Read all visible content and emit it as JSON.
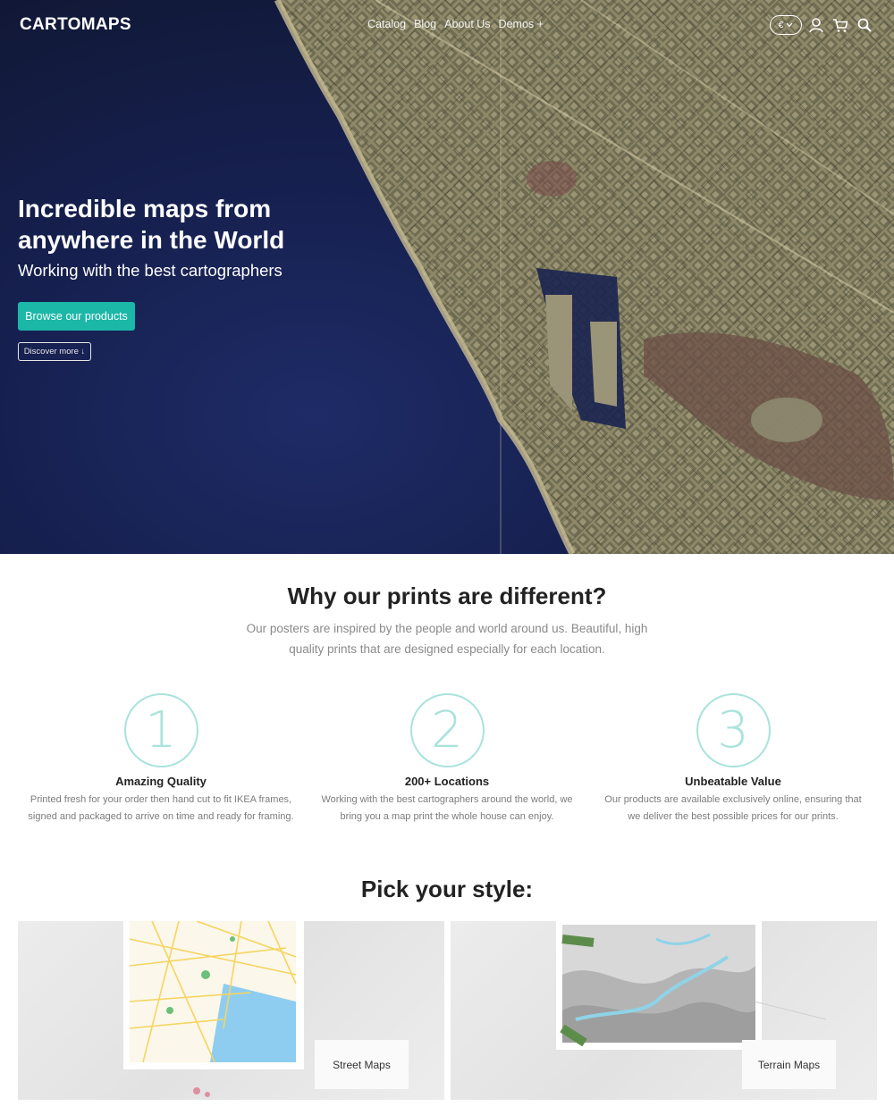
{
  "header": {
    "logo": "CARTOMAPS",
    "nav": [
      "Catalog",
      "Blog",
      "About Us",
      "Demos +"
    ],
    "currency": "€",
    "icons": [
      "account-icon",
      "cart-icon",
      "search-icon"
    ]
  },
  "hero": {
    "title": "Incredible maps from anywhere in the World",
    "subtitle": "Working with the best cartographers",
    "primary_button": "Browse our products",
    "secondary_button": "Discover more ↓"
  },
  "why": {
    "title": "Why our prints are different?",
    "description": "Our posters are inspired by the people and world around us. Beautiful, high quality prints that are designed especially for each location.",
    "features": [
      {
        "number": "1",
        "title": "Amazing Quality",
        "description": "Printed fresh for your order then hand cut to fit IKEA frames, signed and packaged to arrive on time and ready for framing."
      },
      {
        "number": "2",
        "title": "200+ Locations",
        "description": "Working with the best cartographers around the world, we bring you a map print the whole house can enjoy."
      },
      {
        "number": "3",
        "title": "Unbeatable Value",
        "description": "Our products are available exclusively online, ensuring that we deliver the best possible prices for our prints."
      }
    ]
  },
  "styles": {
    "title": "Pick your style:",
    "cards": [
      {
        "label": "Street Maps"
      },
      {
        "label": "Terrain Maps"
      }
    ]
  },
  "colors": {
    "accent": "#1bb7a7",
    "circle": "#a9e3db",
    "ocean": "#16204f"
  }
}
